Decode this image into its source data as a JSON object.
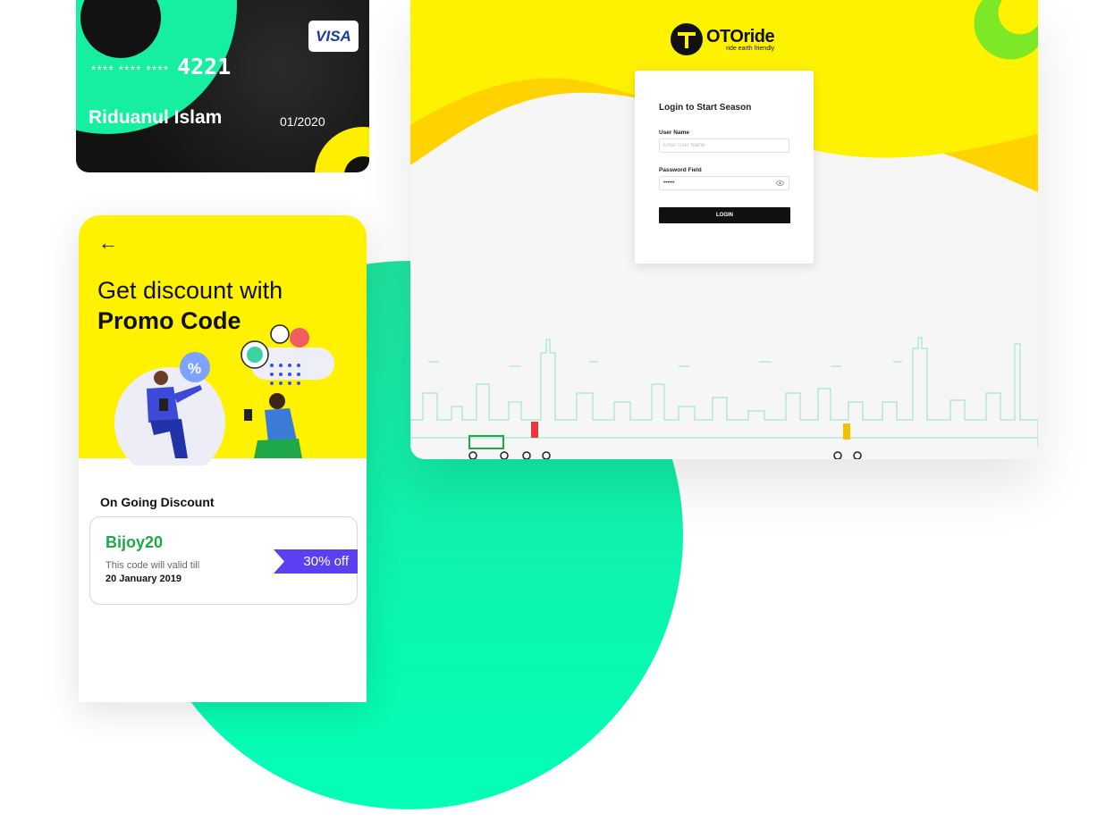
{
  "card": {
    "brand": "VISA",
    "masked_groups": "**** **** ****",
    "last4": "4221",
    "holder": "Riduanul Islam",
    "expiry": "01/2020"
  },
  "promo": {
    "title_line1": "Get discount with",
    "title_line2": "Promo Code",
    "section_title": "On Going Discount",
    "code": "Bijoy20",
    "note": "This code will valid till",
    "date": "20 January 2019",
    "discount": "30% off",
    "colors": {
      "accent": "#fff200",
      "ribbon": "#5a40f0",
      "code": "#1ea84a"
    }
  },
  "login": {
    "brand_name": "OTOride",
    "brand_tagline": "ride earth friendly",
    "title": "Login to Start Season",
    "username_label": "User Name",
    "username_placeholder": "Enter User Name",
    "password_label": "Password Field",
    "password_value": "••••••",
    "button": "LOGIN"
  },
  "icons": [
    "back-arrow-icon",
    "eye-icon",
    "visa-logo",
    "otoride-logo-icon"
  ]
}
